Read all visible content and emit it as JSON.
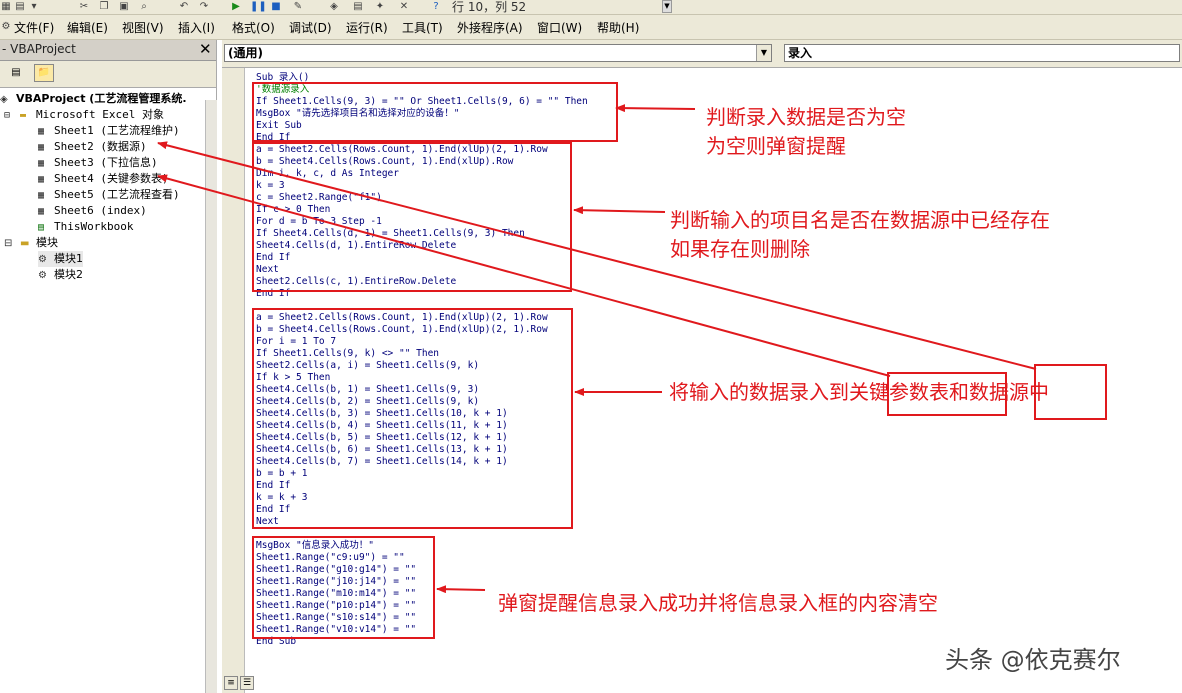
{
  "toolbar": {
    "position": "行 10，列 52",
    "icons": [
      "excel-icon",
      "insert-module-icon",
      "cut-icon",
      "copy-icon",
      "paste-icon",
      "find-icon",
      "undo-icon",
      "redo-icon",
      "run-icon",
      "pause-icon",
      "stop-icon",
      "design-mode-icon",
      "project-explorer-icon",
      "properties-icon",
      "object-browser-icon",
      "toolbox-icon",
      "help-icon"
    ]
  },
  "menu": [
    {
      "label": "文件(F)"
    },
    {
      "label": "编辑(E)"
    },
    {
      "label": "视图(V)"
    },
    {
      "label": "插入(I)"
    },
    {
      "label": "格式(O)"
    },
    {
      "label": "调试(D)"
    },
    {
      "label": "运行(R)"
    },
    {
      "label": "工具(T)"
    },
    {
      "label": "外接程序(A)"
    },
    {
      "label": "窗口(W)"
    },
    {
      "label": "帮助(H)"
    }
  ],
  "project_panel": {
    "title": "- VBAProject",
    "close": "✕",
    "tree": [
      {
        "label": "VBAProject (工艺流程管理系统.",
        "icon": "project-icon",
        "bold": true
      },
      {
        "label": "Microsoft Excel 对象",
        "icon": "folder-icon"
      },
      {
        "label": "Sheet1 (工艺流程维护)",
        "icon": "sheet-icon"
      },
      {
        "label": "Sheet2 (数据源)",
        "icon": "sheet-icon"
      },
      {
        "label": "Sheet3 (下拉信息)",
        "icon": "sheet-icon"
      },
      {
        "label": "Sheet4 (关键参数表)",
        "icon": "sheet-icon"
      },
      {
        "label": "Sheet5 (工艺流程查看)",
        "icon": "sheet-icon"
      },
      {
        "label": "Sheet6 (index)",
        "icon": "sheet-icon"
      },
      {
        "label": "ThisWorkbook",
        "icon": "workbook-icon"
      },
      {
        "label": "模块",
        "icon": "folder-icon"
      },
      {
        "label": "模块1",
        "icon": "module-icon"
      },
      {
        "label": "模块2",
        "icon": "module-icon"
      }
    ]
  },
  "code_window": {
    "object_combo": "(通用)",
    "proc_combo": "录入",
    "lines": [
      "Sub 录入()",
      "'数据源录入",
      "If Sheet1.Cells(9, 3) = \"\" Or Sheet1.Cells(9, 6) = \"\" Then",
      "MsgBox \"请先选择项目名和选择对应的设备！\"",
      "Exit Sub",
      "End If",
      "a = Sheet2.Cells(Rows.Count, 1).End(xlUp)(2, 1).Row",
      "b = Sheet4.Cells(Rows.Count, 1).End(xlUp).Row",
      "Dim i, k, c, d As Integer",
      "k = 3",
      "c = Sheet2.Range(\"f1\")",
      "If c > 0 Then",
      "For d = b To 3 Step -1",
      "If Sheet4.Cells(d, 1) = Sheet1.Cells(9, 3) Then",
      "Sheet4.Cells(d, 1).EntireRow.Delete",
      "End If",
      "Next",
      "Sheet2.Cells(c, 1).EntireRow.Delete",
      "End If",
      "",
      "a = Sheet2.Cells(Rows.Count, 1).End(xlUp)(2, 1).Row",
      "b = Sheet4.Cells(Rows.Count, 1).End(xlUp)(2, 1).Row",
      "For i = 1 To 7",
      "If Sheet1.Cells(9, k) <> \"\" Then",
      "Sheet2.Cells(a, i) = Sheet1.Cells(9, k)",
      "If k > 5 Then",
      "Sheet4.Cells(b, 1) = Sheet1.Cells(9, 3)",
      "Sheet4.Cells(b, 2) = Sheet1.Cells(9, k)",
      "Sheet4.Cells(b, 3) = Sheet1.Cells(10, k + 1)",
      "Sheet4.Cells(b, 4) = Sheet1.Cells(11, k + 1)",
      "Sheet4.Cells(b, 5) = Sheet1.Cells(12, k + 1)",
      "Sheet4.Cells(b, 6) = Sheet1.Cells(13, k + 1)",
      "Sheet4.Cells(b, 7) = Sheet1.Cells(14, k + 1)",
      "b = b + 1",
      "End If",
      "k = k + 3",
      "End If",
      "Next",
      "",
      "MsgBox \"信息录入成功！\"",
      "Sheet1.Range(\"c9:u9\") = \"\"",
      "Sheet1.Range(\"g10:g14\") = \"\"",
      "Sheet1.Range(\"j10:j14\") = \"\"",
      "Sheet1.Range(\"m10:m14\") = \"\"",
      "Sheet1.Range(\"p10:p14\") = \"\"",
      "Sheet1.Range(\"s10:s14\") = \"\"",
      "Sheet1.Range(\"v10:v14\") = \"\"",
      "End Sub"
    ]
  },
  "annotations": {
    "callout1_line1": "判断录入数据是否为空",
    "callout1_line2": "为空则弹窗提醒",
    "callout2_line1": "判断输入的项目名是否在数据源中已经存在",
    "callout2_line2": "如果存在则删除",
    "callout3": "将输入的数据录入到关键参数表和数据源中",
    "callout4": "弹窗提醒信息录入成功并将信息录入框的内容清空",
    "annotation_color": "#e0191d"
  },
  "watermark": "头条 @依克赛尔"
}
